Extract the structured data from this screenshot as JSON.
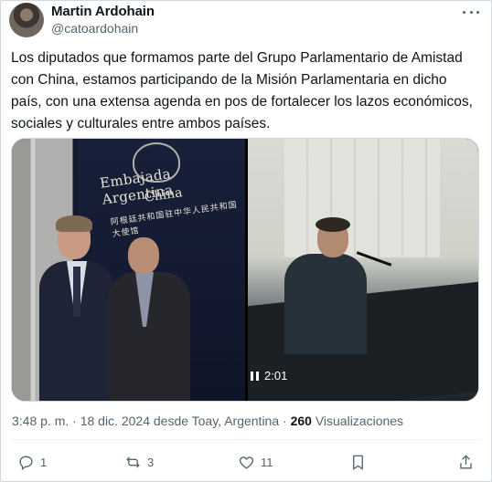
{
  "author": {
    "name": "Martin Ardohain",
    "handle": "@catoardohain"
  },
  "tweet": {
    "text": "Los diputados que formamos parte del Grupo Parlamentario de Amistad\ncon China, estamos participando de la Misión Parlamentaria en dicho\npaís, con una extensa agenda en pos de fortalecer los lazos económicos,\nsociales y culturales entre ambos países."
  },
  "media": {
    "photo": {
      "banner_line1": "Embajada Argentina",
      "banner_line2": "China",
      "banner_cn": "阿根廷共和国驻中华人民共和国大使馆"
    },
    "video": {
      "duration": "2:01",
      "state_icon": "pause-icon"
    }
  },
  "meta": {
    "timestamp": "3:48 p. m. · 18 dic. 2024 desde Toay, Argentina ·",
    "views_count": "260",
    "views_label": "Visualizaciones"
  },
  "actions": {
    "replies": "1",
    "reposts": "3",
    "likes": "11"
  },
  "icons": {
    "reply": "reply-icon",
    "repost": "repost-icon",
    "like": "heart-icon",
    "bookmark": "bookmark-icon",
    "share": "share-icon",
    "more": "more-icon"
  },
  "colors": {
    "text": "#0f1419",
    "secondary": "#536471",
    "border": "#cfd9de"
  }
}
